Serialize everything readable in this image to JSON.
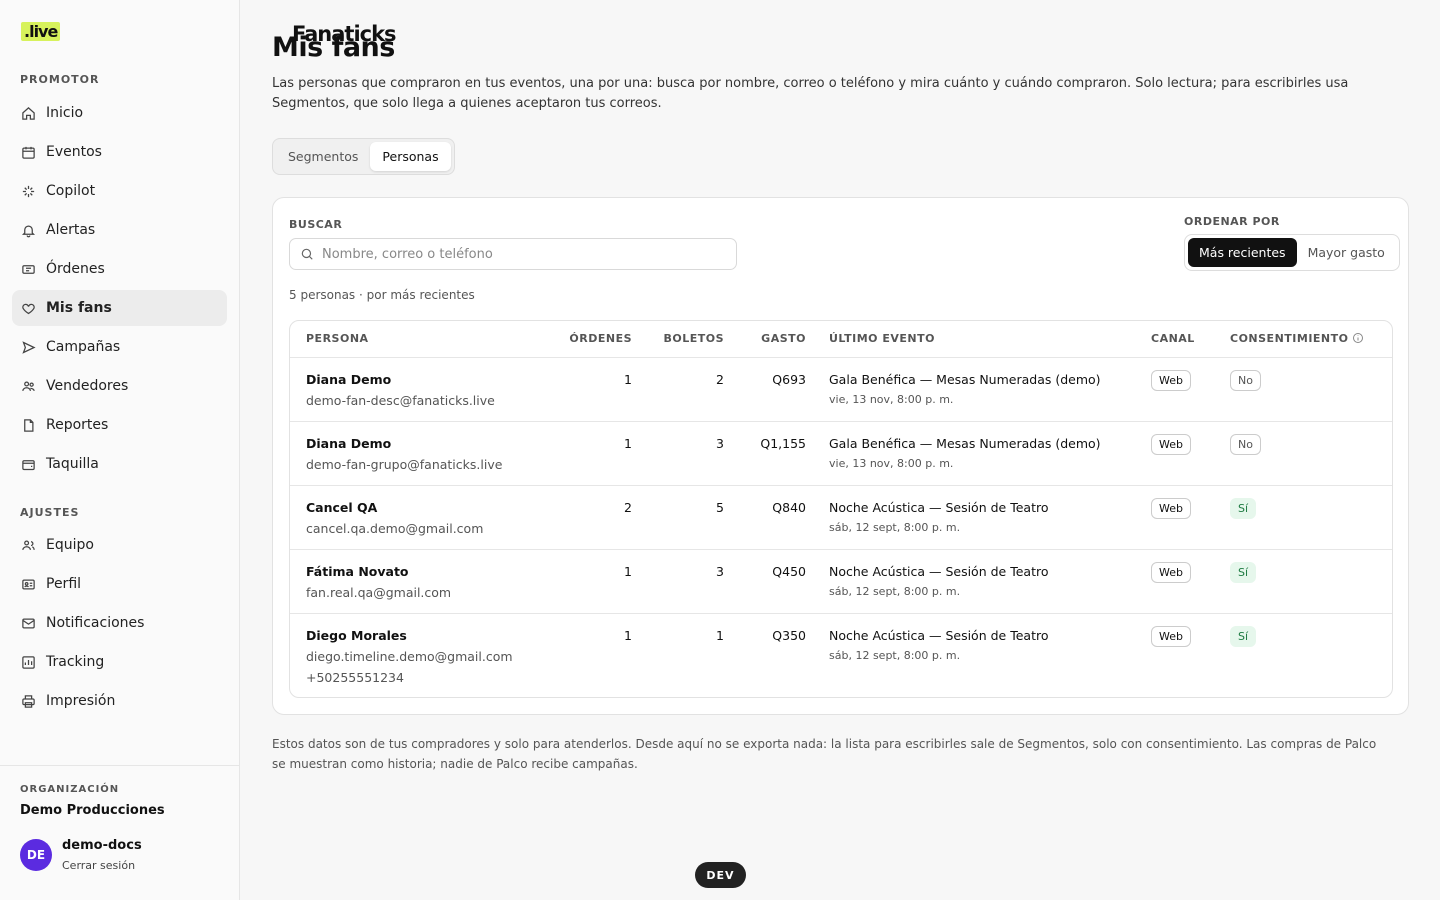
{
  "brand": {
    "name": "Fanaticks",
    "suffix": ".live",
    "highlight": "#d7f25c"
  },
  "sidebar": {
    "promoter_label": "PROMOTOR",
    "promoter_items": [
      {
        "label": "Inicio",
        "icon": "home-icon"
      },
      {
        "label": "Eventos",
        "icon": "calendar-icon"
      },
      {
        "label": "Copilot",
        "icon": "sparkle-icon"
      },
      {
        "label": "Alertas",
        "icon": "bell-icon"
      },
      {
        "label": "Órdenes",
        "icon": "ticket-icon"
      },
      {
        "label": "Mis fans",
        "icon": "heart-icon",
        "active": true
      },
      {
        "label": "Campañas",
        "icon": "send-icon"
      },
      {
        "label": "Vendedores",
        "icon": "users-icon"
      },
      {
        "label": "Reportes",
        "icon": "file-icon"
      },
      {
        "label": "Taquilla",
        "icon": "wallet-icon"
      }
    ],
    "settings_label": "AJUSTES",
    "settings_items": [
      {
        "label": "Equipo",
        "icon": "team-icon"
      },
      {
        "label": "Perfil",
        "icon": "id-card-icon"
      },
      {
        "label": "Notificaciones",
        "icon": "mail-icon"
      },
      {
        "label": "Tracking",
        "icon": "chart-icon"
      },
      {
        "label": "Impresión",
        "icon": "printer-icon"
      }
    ],
    "org_label": "ORGANIZACIÓN",
    "org_name": "Demo Producciones",
    "user": {
      "initials": "DE",
      "name": "demo-docs",
      "logout": "Cerrar sesión",
      "avatar_color": "#5b2be0"
    }
  },
  "page": {
    "title": "Mis fans",
    "description": "Las personas que compraron en tus eventos, una por una: busca por nombre, correo o teléfono y mira cuánto y cuándo compraron. Solo lectura; para escribirles usa Segmentos, que solo llega a quienes aceptaron tus correos.",
    "tabs": [
      "Segmentos",
      "Personas"
    ],
    "active_tab": "Personas"
  },
  "search": {
    "label": "BUSCAR",
    "placeholder": "Nombre, correo o teléfono",
    "value": ""
  },
  "order": {
    "label": "ORDENAR POR",
    "options": [
      "Más recientes",
      "Mayor gasto"
    ],
    "selected": "Más recientes"
  },
  "count_text": "5 personas · por más recientes",
  "table": {
    "headers": {
      "persona": "PERSONA",
      "ordenes": "ÓRDENES",
      "boletos": "BOLETOS",
      "gasto": "GASTO",
      "evento": "ÚLTIMO EVENTO",
      "canal": "CANAL",
      "consentimiento": "CONSENTIMIENTO"
    },
    "rows": [
      {
        "name": "Diana Demo",
        "email": "demo-fan-desc@fanaticks.live",
        "phone": "",
        "orders": "1",
        "tickets": "2",
        "spend": "Q693",
        "event": "Gala Benéfica — Mesas Numeradas (demo)",
        "event_date": "vie, 13 nov, 8:00 p. m.",
        "channel": "Web",
        "consent": "No"
      },
      {
        "name": "Diana Demo",
        "email": "demo-fan-grupo@fanaticks.live",
        "phone": "",
        "orders": "1",
        "tickets": "3",
        "spend": "Q1,155",
        "event": "Gala Benéfica — Mesas Numeradas (demo)",
        "event_date": "vie, 13 nov, 8:00 p. m.",
        "channel": "Web",
        "consent": "No"
      },
      {
        "name": "Cancel QA",
        "email": "cancel.qa.demo@gmail.com",
        "phone": "",
        "orders": "2",
        "tickets": "5",
        "spend": "Q840",
        "event": "Noche Acústica — Sesión de Teatro",
        "event_date": "sáb, 12 sept, 8:00 p. m.",
        "channel": "Web",
        "consent": "Sí"
      },
      {
        "name": "Fátima Novato",
        "email": "fan.real.qa@gmail.com",
        "phone": "",
        "orders": "1",
        "tickets": "3",
        "spend": "Q450",
        "event": "Noche Acústica — Sesión de Teatro",
        "event_date": "sáb, 12 sept, 8:00 p. m.",
        "channel": "Web",
        "consent": "Sí"
      },
      {
        "name": "Diego Morales",
        "email": "diego.timeline.demo@gmail.com",
        "phone": "+50255551234",
        "orders": "1",
        "tickets": "1",
        "spend": "Q350",
        "event": "Noche Acústica — Sesión de Teatro",
        "event_date": "sáb, 12 sept, 8:00 p. m.",
        "channel": "Web",
        "consent": "Sí"
      }
    ]
  },
  "footer_note": "Estos datos son de tus compradores y solo para atenderlos. Desde aquí no se exporta nada: la lista para escribirles sale de Segmentos, solo con consentimiento. Las compras de Palco se muestran como historia; nadie de Palco recibe campañas.",
  "dev_badge": "DEV"
}
